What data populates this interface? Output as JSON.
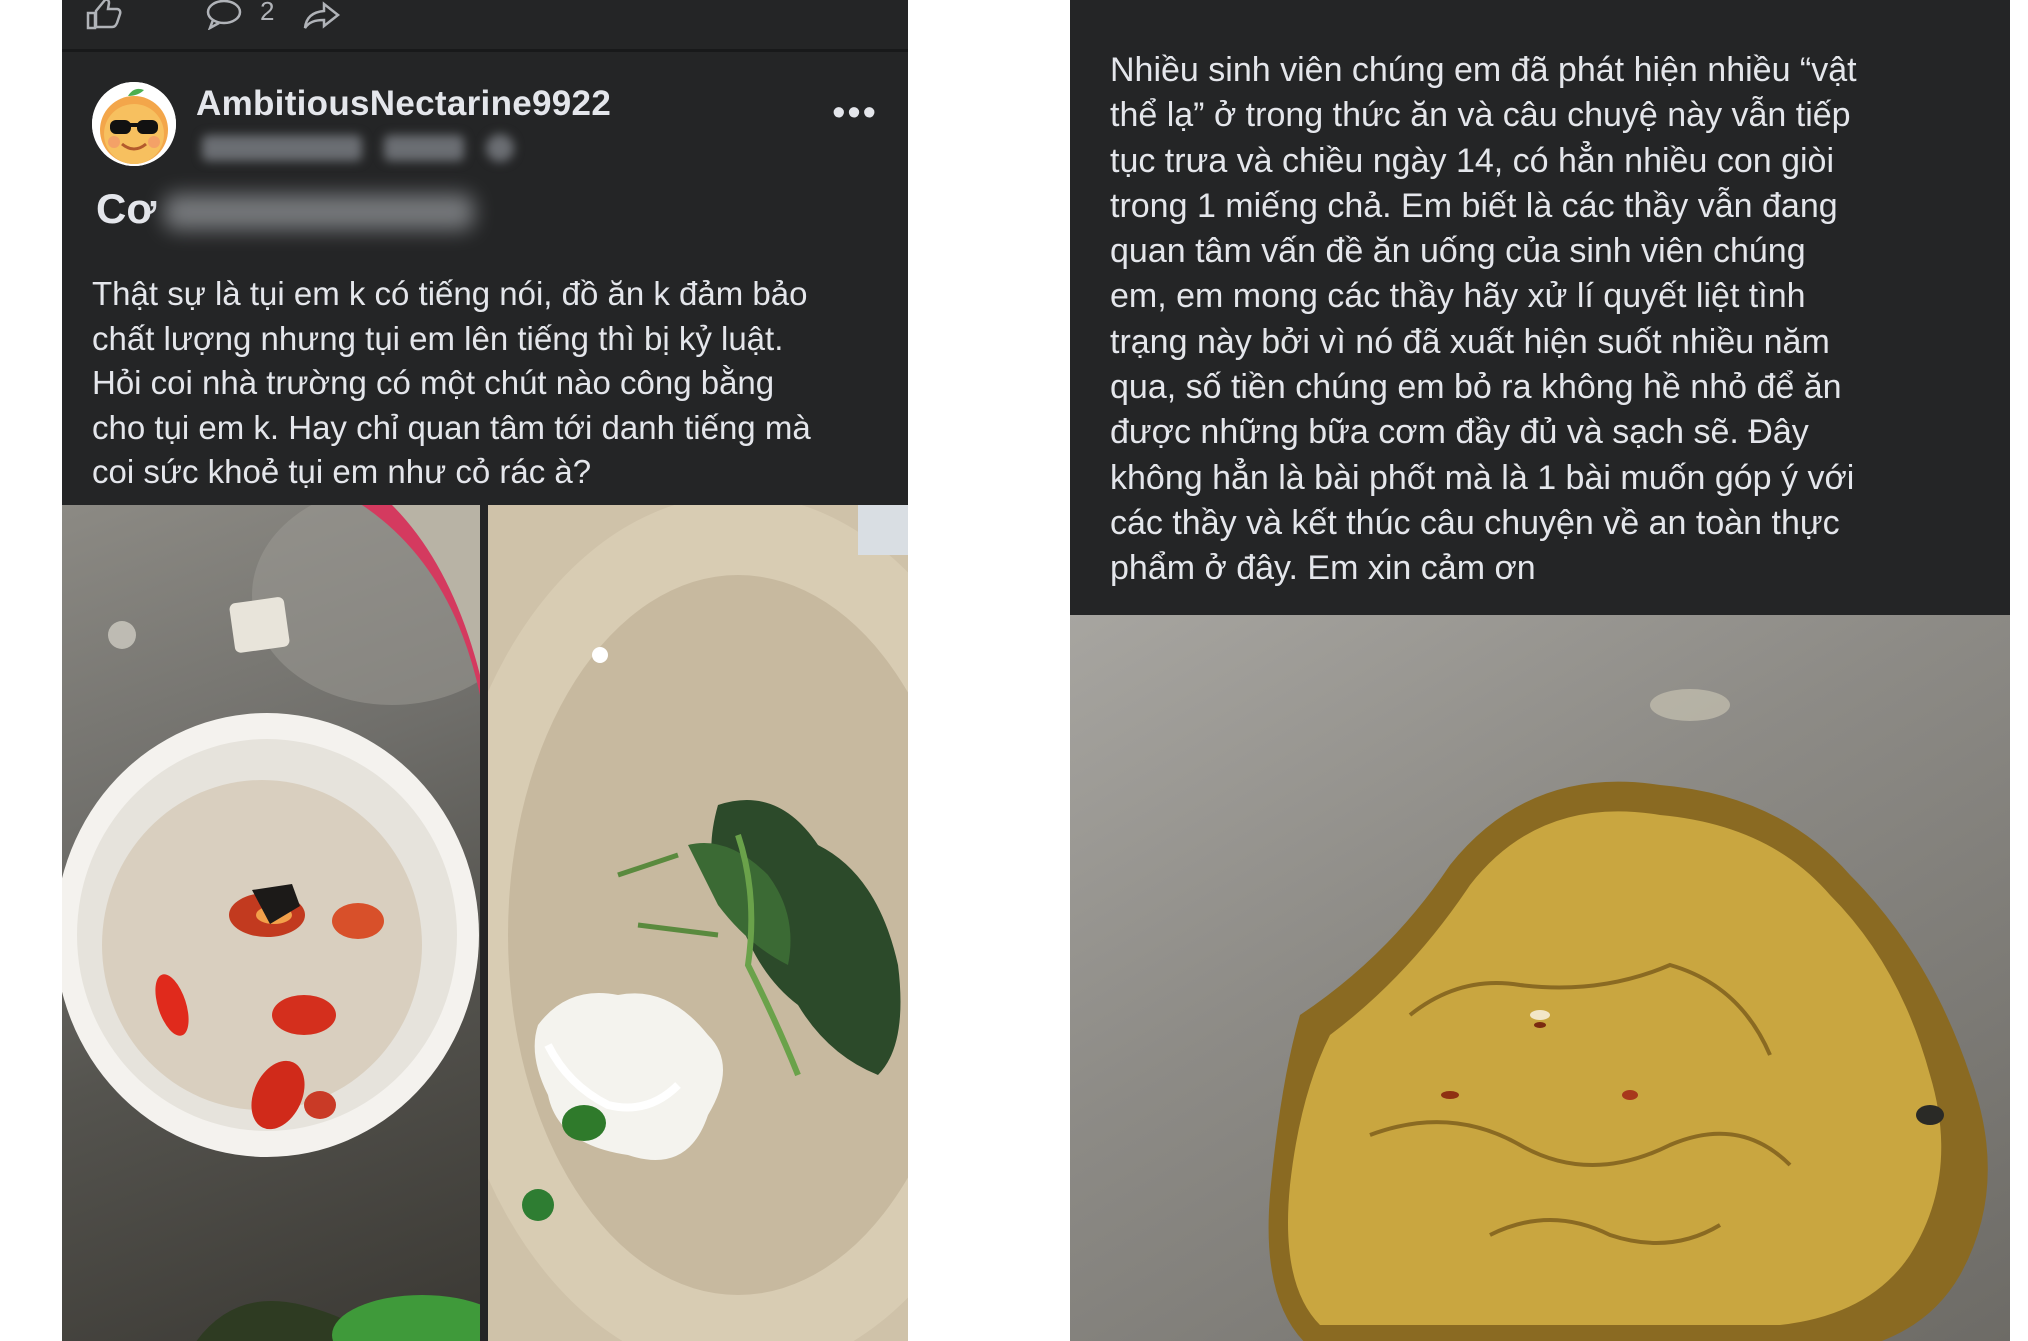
{
  "left_post": {
    "actions": {
      "like_icon": "thumbs-up-icon",
      "comment_icon": "comment-icon",
      "comment_count": "2",
      "share_icon": "share-icon"
    },
    "author": "AmbitiousNectarine9922",
    "title_visible": "Cơ",
    "body": "Thật sự là tụi em k có tiếng nói, đồ ăn k đảm bảo\nchất lượng nhưng tụi em lên tiếng thì bị kỷ luật.\nHỏi coi nhà trường có một chút nào công bằng\ncho tụi em k. Hay chỉ quan tâm tới danh tiếng mà\ncoi sức khoẻ tụi em như cỏ rác à?",
    "more_label": "•••"
  },
  "right_post": {
    "body": "Nhiều sinh viên chúng em đã phát hiện nhiều “vật\nthể lạ” ở trong thức ăn và câu chuyệ này vẫn tiếp\ntục trưa và chiều ngày 14, có hẳn nhiều con giòi\ntrong 1 miếng chả. Em biết là các thầy vẫn đang\nquan tâm vấn đề ăn uống của sinh viên chúng\nem, em mong các thầy hãy xử lí quyết liệt tình\ntrạng này bởi vì nó đã xuất hiện suốt nhiều năm\nqua, số tiền chúng em bỏ ra không hề nhỏ để ăn\nđược những bữa cơm đầy đủ và sạch sẽ. Đây\nkhông hẳn là bài phốt mà là 1 bài muốn góp ý với\ncác thầy và kết thúc câu chuyện về an toàn thực\nphẩm ở đây. Em xin cảm ơn"
  },
  "colors": {
    "panel_bg": "#242526",
    "text": "#e4e6eb",
    "muted": "#b0b3b8"
  }
}
